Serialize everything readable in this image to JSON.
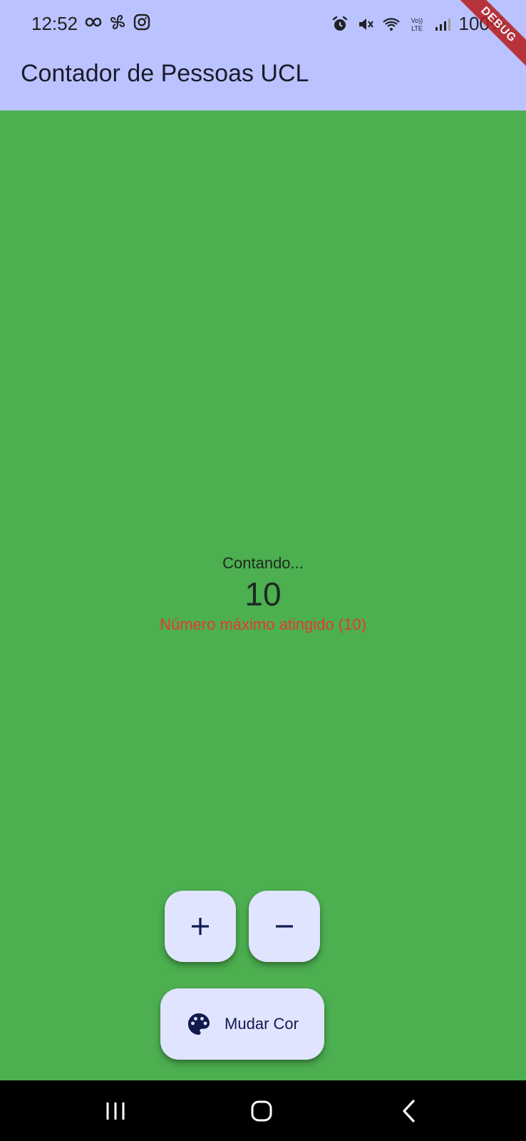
{
  "status_bar": {
    "time": "12:52",
    "battery": "100%"
  },
  "app_bar": {
    "title": "Contador de Pessoas UCL",
    "debug_banner": "DEBUG"
  },
  "counter": {
    "caption": "Contando...",
    "value": "10",
    "warning": "Número máximo atingido (10)"
  },
  "actions": {
    "increment_icon": "plus-icon",
    "decrement_icon": "minus-icon",
    "change_color_label": "Mudar Cor",
    "change_color_icon": "palette-icon"
  },
  "colors": {
    "background": "#4caf50",
    "app_bar": "#bac3ff",
    "fab": "#e0e4ff",
    "warning": "#e53935"
  }
}
